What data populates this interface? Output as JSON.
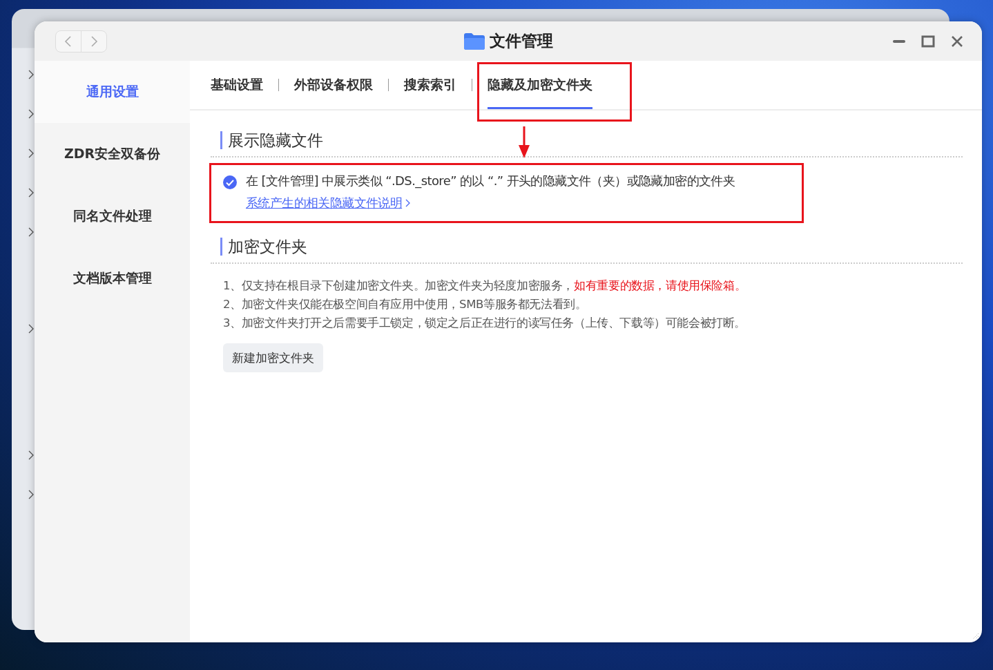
{
  "window": {
    "title": "文件管理"
  },
  "sidebar": {
    "items": [
      {
        "label": "通用设置",
        "selected": true
      },
      {
        "label": "ZDR安全双备份",
        "selected": false
      },
      {
        "label": "同名文件处理",
        "selected": false
      },
      {
        "label": "文档版本管理",
        "selected": false
      }
    ]
  },
  "tabs": [
    {
      "label": "基础设置",
      "selected": false
    },
    {
      "label": "外部设备权限",
      "selected": false
    },
    {
      "label": "搜索索引",
      "selected": false
    },
    {
      "label": "隐藏及加密文件夹",
      "selected": true
    }
  ],
  "hidden_files": {
    "title": "展示隐藏文件",
    "option": {
      "label": "在 [文件管理] 中展示类似 “.DS._store” 的以 “.” 开头的隐藏文件（夹）或隐藏加密的文件夹",
      "checked": true
    },
    "link": "系统产生的相关隐藏文件说明"
  },
  "encrypted_folder": {
    "title": "加密文件夹",
    "notes": [
      [
        {
          "text": "1、仅支持在根目录下创建加密文件夹。加密文件夹为轻度加密服务，",
          "warning": false
        },
        {
          "text": "如有重要的数据，请使用保险箱。",
          "warning": true
        }
      ],
      [
        {
          "text": "2、加密文件夹仅能在极空间自有应用中使用，SMB等服务都无法看到。",
          "warning": false
        }
      ],
      [
        {
          "text": "3、加密文件夹打开之后需要手工锁定，锁定之后正在进行的读写任务（上传、下载等）可能会被打断。",
          "warning": false
        }
      ]
    ],
    "button": "新建加密文件夹"
  }
}
